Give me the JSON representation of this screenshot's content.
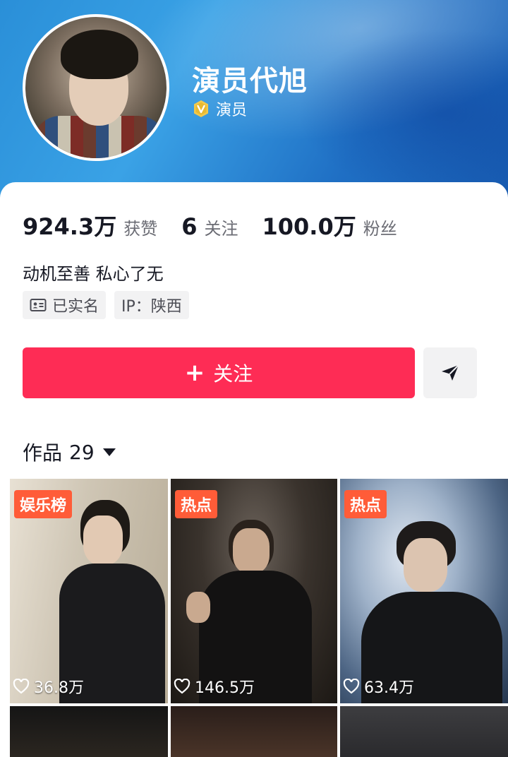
{
  "profile": {
    "name": "演员代旭",
    "verify_label": "演员",
    "bio": "动机至善 私心了无"
  },
  "stats": [
    {
      "value": "924.3万",
      "label": "获赞"
    },
    {
      "value": "6",
      "label": "关注"
    },
    {
      "value": "100.0万",
      "label": "粉丝"
    }
  ],
  "tags": [
    {
      "label": "已实名",
      "icon": "id-card-icon"
    },
    {
      "label": "IP：陕西"
    }
  ],
  "actions": {
    "follow_label": "关注",
    "follow_icon": "plus-icon",
    "share_icon": "send-icon"
  },
  "works": {
    "label": "作品",
    "count": "29"
  },
  "posts": [
    {
      "badge": "娱乐榜",
      "likes": "36.8万"
    },
    {
      "badge": "热点",
      "likes": "146.5万"
    },
    {
      "badge": "热点",
      "likes": "63.4万"
    }
  ],
  "colors": {
    "accent": "#fe2c55",
    "badge": "#ff5c38",
    "verify": "#f2c94c"
  }
}
